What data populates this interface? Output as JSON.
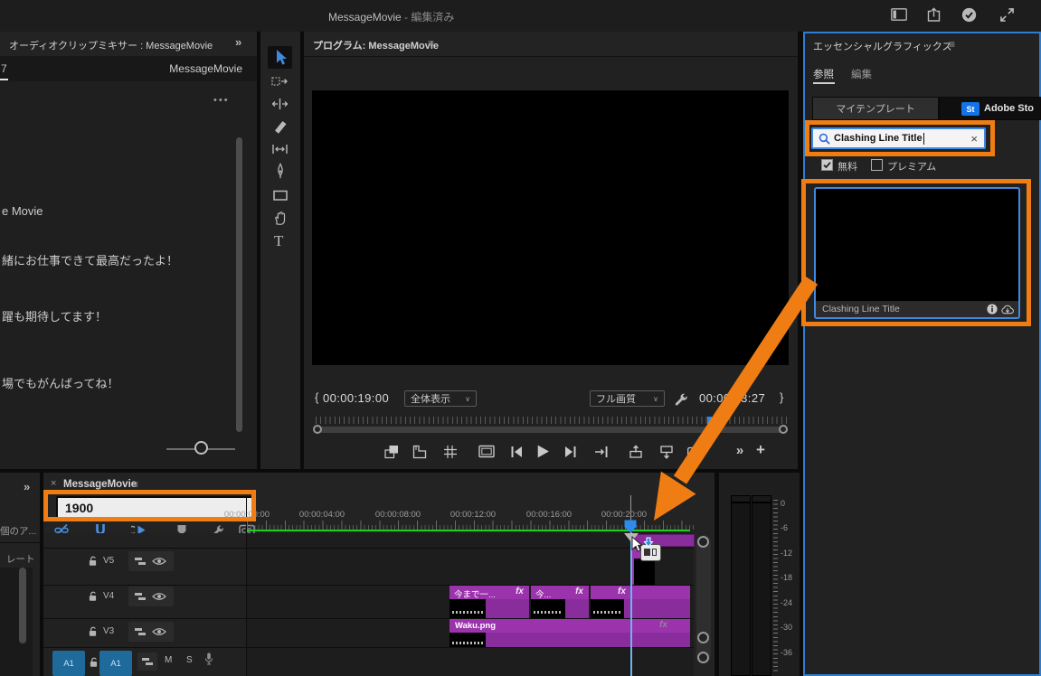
{
  "titlebar": {
    "title": "MessageMovie",
    "suffix": "- 編集済み"
  },
  "topbar_icons": [
    "workspace-icon",
    "quick-export-icon",
    "sync-ok-icon",
    "maximize-icon"
  ],
  "mixer": {
    "panel_title": "オーディオクリップミキサー : MessageMovie",
    "collapse": "»",
    "channel_number": "7",
    "sequence_label": "MessageMovie",
    "more": "•••",
    "messages": [
      "e Movie",
      "緒にお仕事できて最高だったよ！",
      "躍も期待してます！",
      "場でもがんばってね！"
    ]
  },
  "tools": [
    "selection-tool",
    "track-select-forward-tool",
    "ripple-edit-tool",
    "razor-tool",
    "slip-tool",
    "pen-tool",
    "rectangle-tool",
    "hand-tool",
    "type-tool"
  ],
  "program": {
    "panel_title": "プログラム: MessageMovie",
    "menu_glyph": "≡",
    "in_brace": "{",
    "current_time": "00:00:19:00",
    "zoom_select": "全体表示",
    "quality_select": "フル画質",
    "duration": "00:00:23:27",
    "out_brace": "}",
    "more_glyph": "»",
    "plus_glyph": "+",
    "transport_icons": [
      "comparison-view",
      "mark-in",
      "safe-margins",
      "output-monitor",
      "step-back",
      "play",
      "step-forward",
      "go-to-out",
      "lift",
      "extract",
      "export-frame"
    ]
  },
  "eg": {
    "panel_title": "エッセンシャルグラフィックス",
    "menu_glyph": "≡",
    "tab_browse": "参照",
    "tab_edit": "編集",
    "seg_my_templates": "マイテンプレート",
    "stock_badge": "St",
    "seg_adobe_stock": "Adobe Sto",
    "search_value": "Clashing Line Title",
    "clear_glyph": "×",
    "filter_free": "無料",
    "filter_free_checked": true,
    "filter_premium": "プレミアム",
    "filter_premium_checked": false,
    "template_name": "Clashing Line Title"
  },
  "strip": {
    "collapse": "»",
    "text_items": "個のア...",
    "text_rate": "レート"
  },
  "timeline": {
    "tab_close": "×",
    "tab_title": "MessageMovie",
    "menu_glyph": "≡",
    "timecode_input": "1900",
    "toolbar_icons": [
      "linked-selection",
      "snap",
      "nest-insert",
      "add-marker",
      "settings-wrench",
      "captions"
    ],
    "ruler": [
      "00:00:00:00",
      "00:00:04:00",
      "00:00:08:00",
      "00:00:12:00",
      "00:00:16:00",
      "00:00:20:00"
    ],
    "track_v5": "V5",
    "track_v4": "V4",
    "track_v3": "V3",
    "track_a1": "A1",
    "mute": "M",
    "solo": "S",
    "fx": "fx",
    "clips_v4": [
      "今まで一...",
      "今...",
      ""
    ],
    "clip_v3": "Waku.png"
  },
  "meter": {
    "db": [
      "0",
      "-6",
      "-12",
      "-18",
      "-24",
      "-30",
      "-36"
    ]
  },
  "annotation": {
    "color": "#F07D13"
  }
}
